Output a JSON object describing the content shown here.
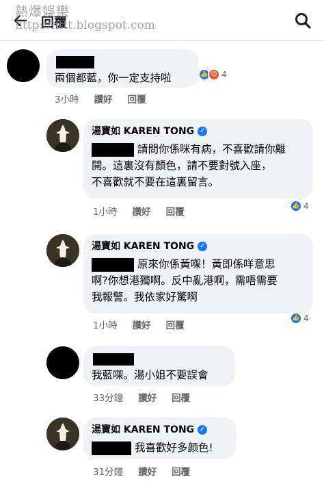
{
  "header": {
    "title": "回覆",
    "watermark_cn": "熱爆娛樂",
    "watermark_url": "http://httt.blogspot.com"
  },
  "colors": {
    "accent": "#1877f2",
    "bubble": "#f0f2f5",
    "meta_text": "#65676b",
    "angry": "#e4572e"
  },
  "actions": {
    "like": "讚好",
    "reply": "回覆"
  },
  "comments": [
    {
      "author": "",
      "text_parts": [
        "兩個都藍，你一定支持啦"
      ],
      "time": "3小時",
      "reaction_count": "4",
      "reaction_icons": [
        "like-icon",
        "angry-icon"
      ]
    },
    {
      "author": "湯寶如 KAREN TONG",
      "text_parts": [
        "請問你係咪有病，不喜歡請你離",
        "開。這裏沒有顏色，請不要對號入座，",
        "不喜歡就不要在這裏留言。"
      ],
      "time": "1小時",
      "reaction_count": "4",
      "reaction_icons": [
        "like-icon"
      ]
    },
    {
      "author": "湯寶如 KAREN TONG",
      "text_parts": [
        "原來你係黃㗎！黃即係咩意思",
        "啊?你想港獨啊。反中亂港啊，需唔需要",
        "我報警。我依家好驚啊"
      ],
      "time": "1小時",
      "reaction_count": "4",
      "reaction_icons": [
        "like-icon"
      ]
    },
    {
      "author": "",
      "text_parts": [
        "我藍㗎。湯小姐不要誤會"
      ],
      "time": "33分鐘"
    },
    {
      "author": "湯寶如 KAREN TONG",
      "text_parts": [
        "我喜歡好多颜色!"
      ],
      "time": "31分鐘"
    }
  ]
}
